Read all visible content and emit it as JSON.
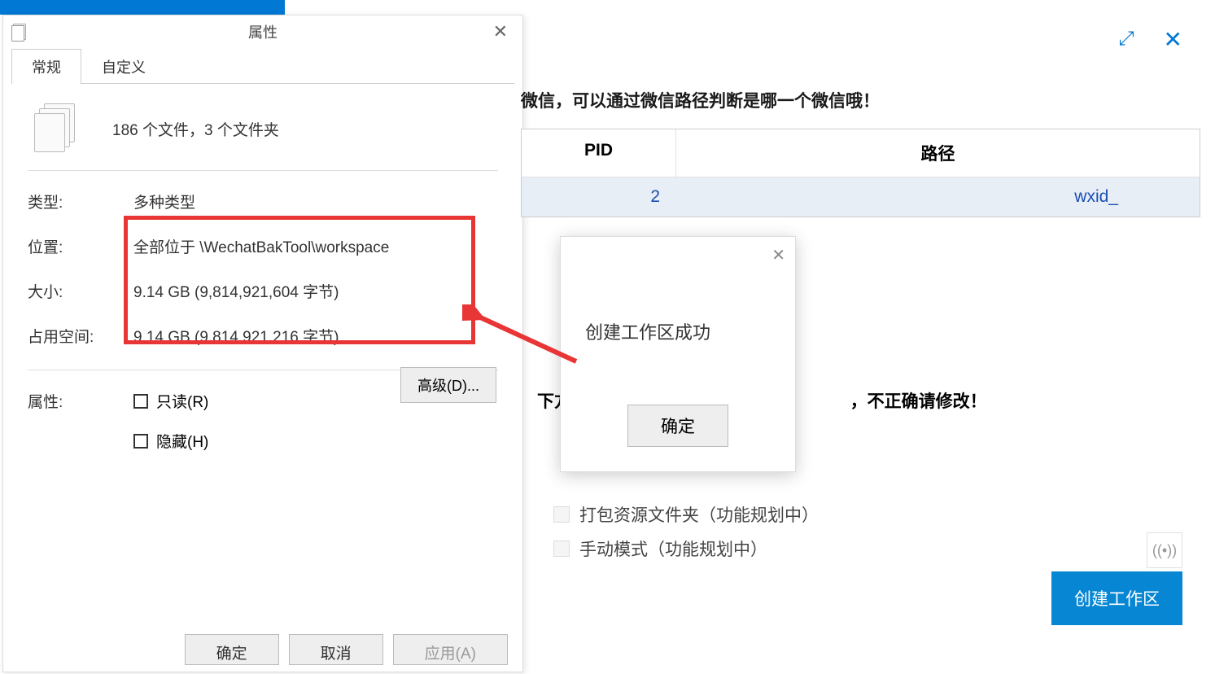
{
  "top_bar": {},
  "props_dialog": {
    "title": "属性",
    "tabs": {
      "general": "常规",
      "custom": "自定义"
    },
    "file_count": "186 个文件，3 个文件夹",
    "rows": {
      "type_label": "类型:",
      "type_value": "多种类型",
      "location_label": "位置:",
      "location_value": "全部位于           \\WechatBakTool\\workspace",
      "size_label": "大小:",
      "size_value": "9.14 GB (9,814,921,604 字节)",
      "disk_label": "占用空间:",
      "disk_value": "9.14 GB (9,814,921,216 字节)",
      "attr_label": "属性:",
      "readonly": "只读(R)",
      "hidden": "隐藏(H)"
    },
    "advanced_btn": "高级(D)...",
    "footer": {
      "ok": "确定",
      "cancel": "取消",
      "apply": "应用(A)"
    }
  },
  "app": {
    "hint": "微信，可以通过微信路径判断是哪一个微信哦！",
    "table": {
      "h_pid": "PID",
      "h_path": "路径",
      "row_pid": "2",
      "row_path": "wxid_"
    },
    "lower_hint_prefix": "下方自",
    "lower_hint_suffix": "，不正确请修改！",
    "checks": {
      "pack": "打包资源文件夹（功能规划中）",
      "manual": "手动模式（功能规划中）"
    },
    "create_btn": "创建工作区"
  },
  "popup": {
    "message": "创建工作区成功",
    "ok": "确定"
  }
}
